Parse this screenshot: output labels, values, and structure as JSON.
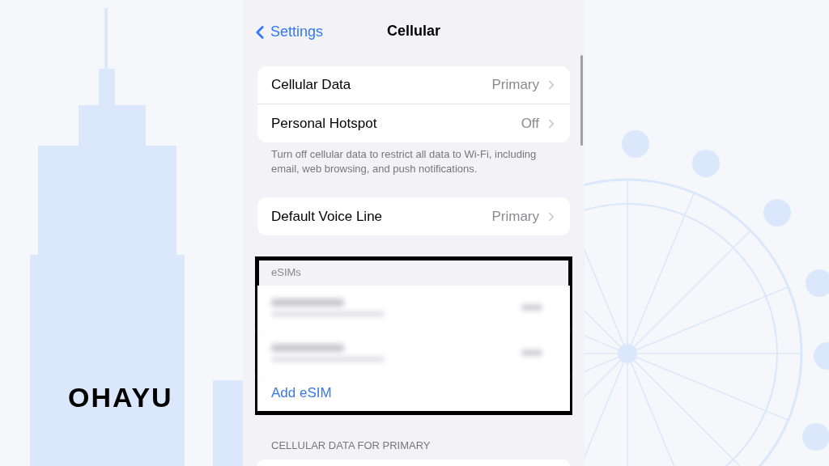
{
  "nav": {
    "back": "Settings",
    "title": "Cellular"
  },
  "group1": {
    "rows": [
      {
        "label": "Cellular Data",
        "value": "Primary"
      },
      {
        "label": "Personal Hotspot",
        "value": "Off"
      }
    ],
    "footer": "Turn off cellular data to restrict all data to Wi-Fi, including email, web browsing, and push notifications."
  },
  "group2": {
    "rows": [
      {
        "label": "Default Voice Line",
        "value": "Primary"
      }
    ]
  },
  "esims": {
    "header": "eSIMs",
    "action": "Add eSIM"
  },
  "section": {
    "header": "CELLULAR DATA FOR PRIMARY"
  },
  "brand": "OHAYU"
}
